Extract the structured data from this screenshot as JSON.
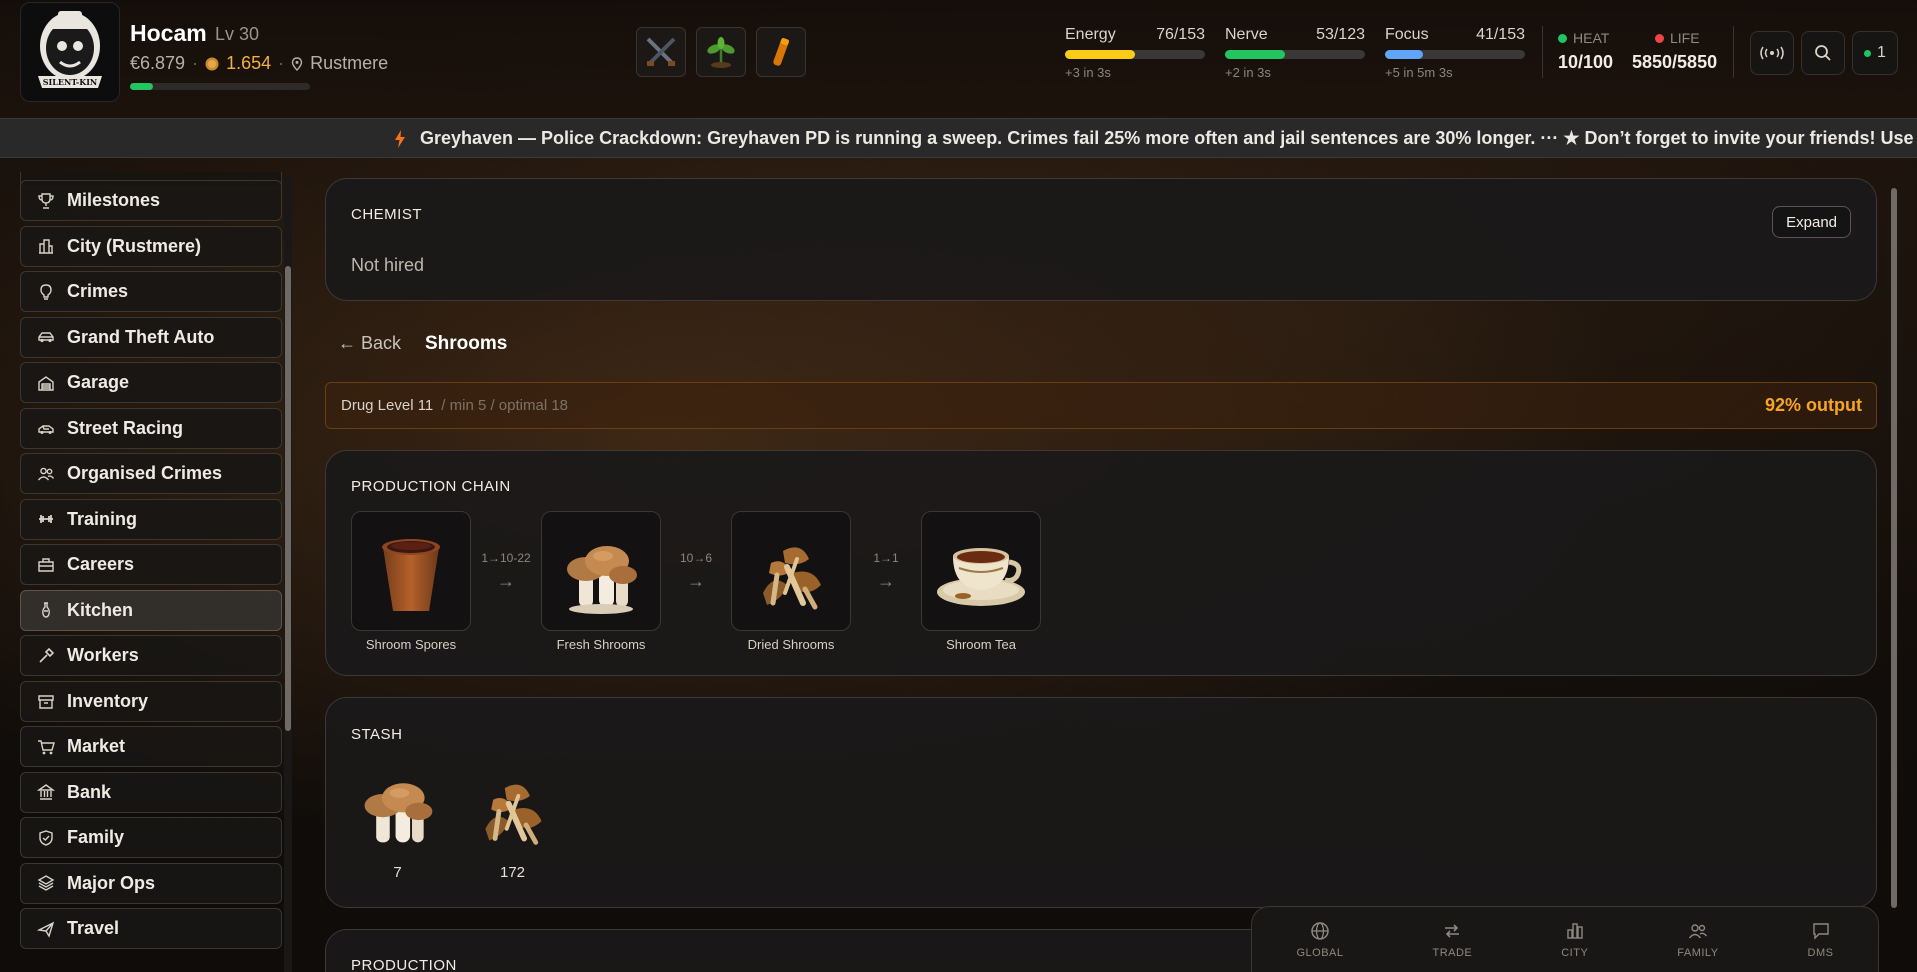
{
  "player": {
    "name": "Hocam",
    "level": "Lv 30",
    "cash": "€6.879",
    "coins": "1.654",
    "location": "Rustmere",
    "xp_progress": 0.13,
    "avatar_text": "SILENT-KIN"
  },
  "quick_items": [
    {
      "icon": "crossed-guns-icon"
    },
    {
      "icon": "plant-sprout-icon"
    },
    {
      "icon": "vial-icon"
    }
  ],
  "stats": {
    "energy": {
      "label": "Energy",
      "value": "76/153",
      "regen": "+3 in 3s",
      "fraction": 0.497,
      "color": "#facc15"
    },
    "nerve": {
      "label": "Nerve",
      "value": "53/123",
      "regen": "+2 in 3s",
      "fraction": 0.431,
      "color": "#22c55e"
    },
    "focus": {
      "label": "Focus",
      "value": "41/153",
      "regen": "+5 in 5m 3s",
      "fraction": 0.268,
      "color": "#60a5fa"
    }
  },
  "heat": {
    "label": "HEAT",
    "value": "10/100",
    "color": "#22c55e"
  },
  "life": {
    "label": "LIFE",
    "value": "5850/5850",
    "color": "#ef4444"
  },
  "header_buttons": {
    "notifications_count": "1"
  },
  "ticker": {
    "text": "Greyhaven — Police Crackdown: Greyhaven PD is running a sweep. Crimes fail 25% more often and jail sentences are 30% longer. ··· ★ Don’t forget to invite your friends! Use your p"
  },
  "sidebar": {
    "items": [
      {
        "label": "Milestones",
        "icon": "trophy-icon"
      },
      {
        "label": "City (Rustmere)",
        "icon": "city-icon"
      },
      {
        "label": "Crimes",
        "icon": "lightbulb-icon"
      },
      {
        "label": "Grand Theft Auto",
        "icon": "car-icon"
      },
      {
        "label": "Garage",
        "icon": "garage-icon"
      },
      {
        "label": "Street Racing",
        "icon": "race-car-icon"
      },
      {
        "label": "Organised Crimes",
        "icon": "people-icon"
      },
      {
        "label": "Training",
        "icon": "dumbbell-icon"
      },
      {
        "label": "Careers",
        "icon": "briefcase-icon"
      },
      {
        "label": "Kitchen",
        "icon": "flask-icon"
      },
      {
        "label": "Workers",
        "icon": "hammer-icon"
      },
      {
        "label": "Inventory",
        "icon": "box-icon"
      },
      {
        "label": "Market",
        "icon": "cart-icon"
      },
      {
        "label": "Bank",
        "icon": "bank-icon"
      },
      {
        "label": "Family",
        "icon": "shield-icon"
      },
      {
        "label": "Major Ops",
        "icon": "layers-icon"
      },
      {
        "label": "Travel",
        "icon": "plane-icon"
      }
    ],
    "active": "Kitchen"
  },
  "chemist": {
    "title": "CHEMIST",
    "status": "Not hired",
    "expand_label": "Expand"
  },
  "page": {
    "back_label": "← Back",
    "title": "Shrooms"
  },
  "drug_level": {
    "label": "Drug Level 11",
    "meta": "/ min 5 / optimal 18",
    "output": "92% output",
    "output_color": "#f5a524"
  },
  "production_chain": {
    "title": "PRODUCTION CHAIN",
    "steps": [
      {
        "name": "Shroom Spores",
        "icon": "spore-pot-icon"
      },
      {
        "name": "Fresh Shrooms",
        "icon": "fresh-mushroom-icon"
      },
      {
        "name": "Dried Shrooms",
        "icon": "dried-mushroom-icon"
      },
      {
        "name": "Shroom Tea",
        "icon": "tea-cup-icon"
      }
    ],
    "ratios": [
      "1→10-22",
      "10→6",
      "1→1"
    ]
  },
  "stash": {
    "title": "STASH",
    "items": [
      {
        "icon": "fresh-mushroom-icon",
        "quantity": "7"
      },
      {
        "icon": "dried-mushroom-icon",
        "quantity": "172"
      }
    ]
  },
  "production": {
    "title": "PRODUCTION"
  },
  "bottom_nav": {
    "items": [
      {
        "label": "GLOBAL",
        "icon": "globe-icon"
      },
      {
        "label": "TRADE",
        "icon": "swap-icon"
      },
      {
        "label": "CITY",
        "icon": "bar-chart-icon"
      },
      {
        "label": "FAMILY",
        "icon": "people-icon"
      },
      {
        "label": "DMS",
        "icon": "chat-icon"
      }
    ]
  }
}
